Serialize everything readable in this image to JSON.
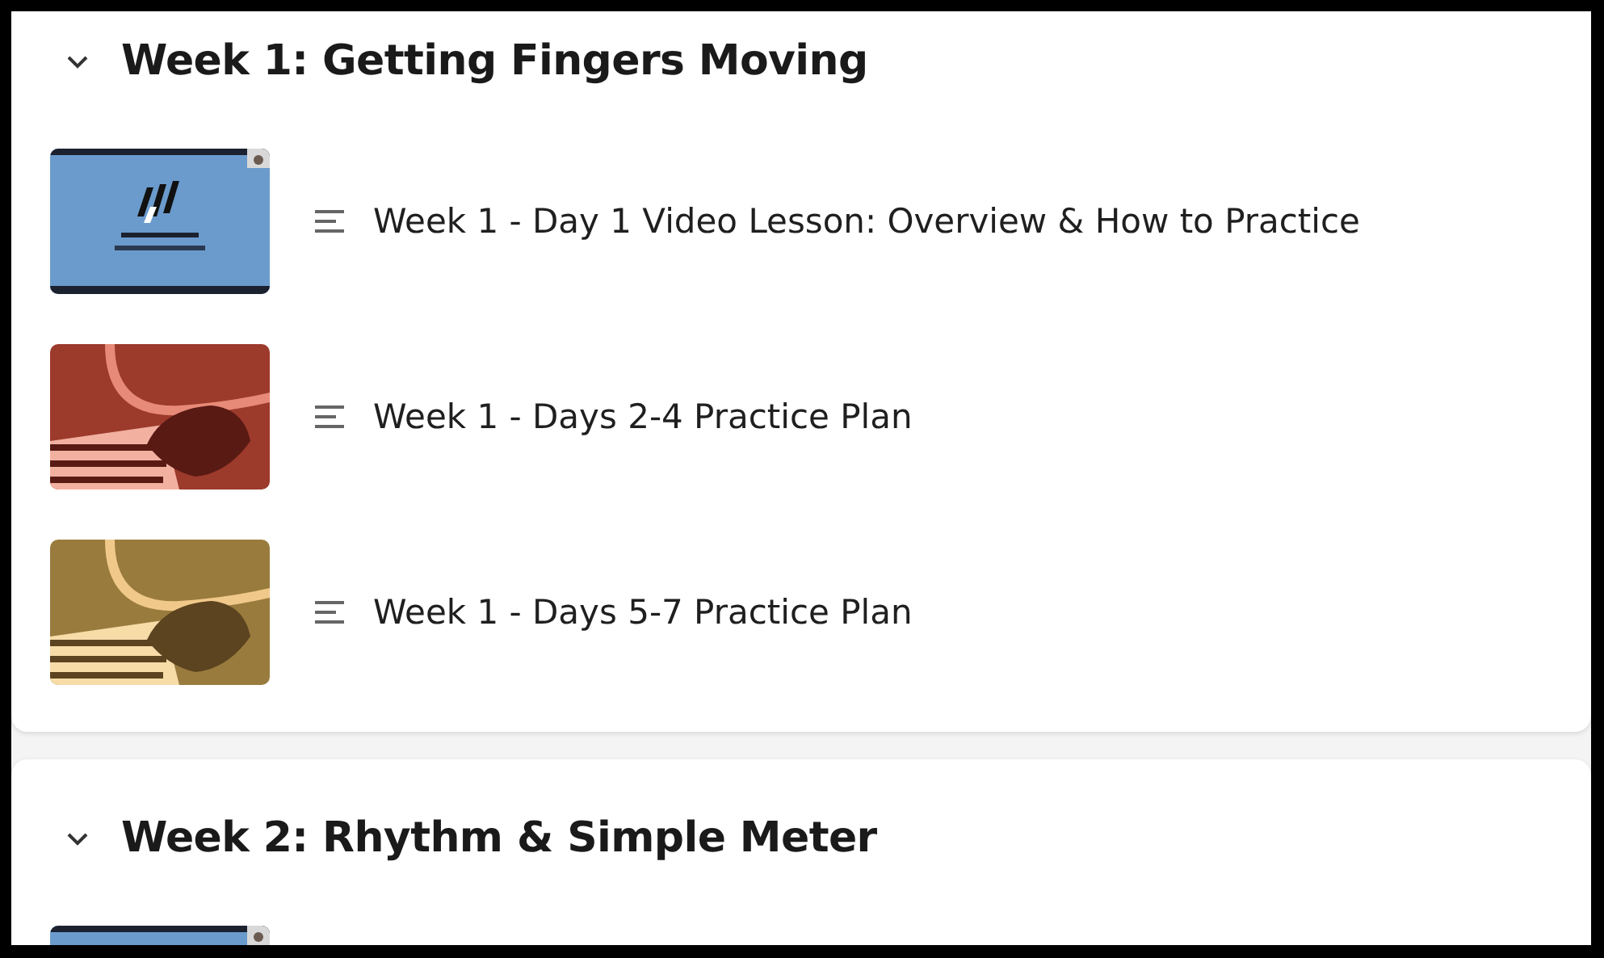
{
  "sections": [
    {
      "title": "Week 1: Getting Fingers Moving",
      "expanded": true,
      "lessons": [
        {
          "title": "Week 1 - Day 1 Video Lesson: Overview & How to Practice"
        },
        {
          "title": "Week 1 - Days 2-4 Practice Plan"
        },
        {
          "title": "Week 1 - Days 5-7 Practice Plan"
        }
      ]
    },
    {
      "title": "Week 2: Rhythm & Simple Meter",
      "expanded": true
    }
  ]
}
